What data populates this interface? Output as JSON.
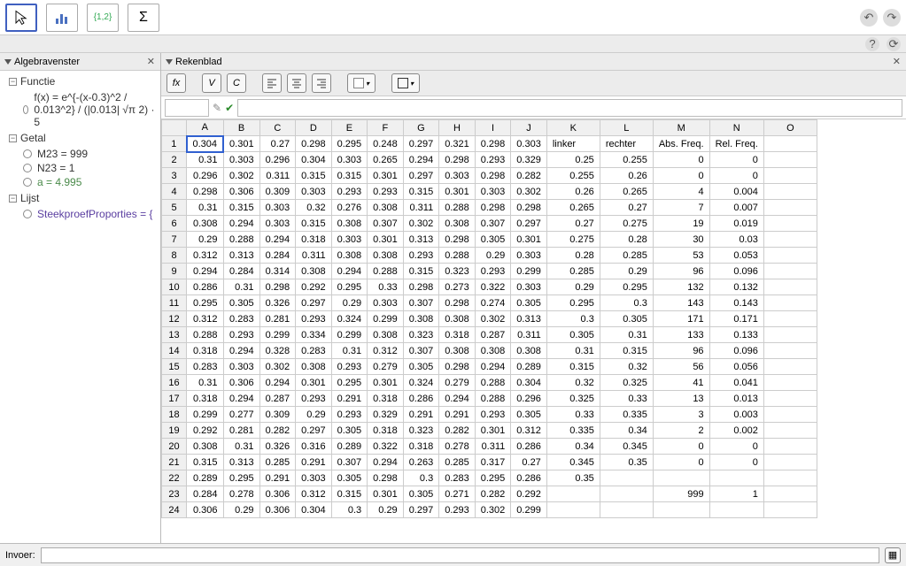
{
  "leftPanel": {
    "title": "Algebravenster",
    "sections": [
      {
        "label": "Functie",
        "items": [
          {
            "text": "f(x) = e^{-(x-0.3)^2 / 0.013^2} / (|0.013| √π 2) · 5"
          }
        ]
      },
      {
        "label": "Getal",
        "items": [
          {
            "text": "M23 = 999"
          },
          {
            "text": "N23 = 1"
          },
          {
            "text": "a = 4.995",
            "cls": "special"
          }
        ]
      },
      {
        "label": "Lijst",
        "items": [
          {
            "text": "SteekproefProporties = {",
            "cls": "purple"
          }
        ]
      }
    ]
  },
  "sheet": {
    "title": "Rekenblad",
    "buttons": {
      "fx": "fx",
      "v": "V",
      "c": "C"
    },
    "columns": [
      "A",
      "B",
      "C",
      "D",
      "E",
      "F",
      "G",
      "H",
      "I",
      "J",
      "K",
      "L",
      "M",
      "N",
      "O"
    ],
    "headerRow": {
      "K": "linker",
      "L": "rechter",
      "M": "Abs. Freq.",
      "N": "Rel. Freq."
    },
    "rows": [
      {
        "n": 1,
        "A": 0.304,
        "B": 0.301,
        "C": 0.27,
        "D": 0.298,
        "E": 0.295,
        "F": 0.248,
        "G": 0.297,
        "H": 0.321,
        "I": 0.298,
        "J": 0.303
      },
      {
        "n": 2,
        "A": 0.31,
        "B": 0.303,
        "C": 0.296,
        "D": 0.304,
        "E": 0.303,
        "F": 0.265,
        "G": 0.294,
        "H": 0.298,
        "I": 0.293,
        "J": 0.329,
        "K": 0.25,
        "L": 0.255,
        "M": 0,
        "N": 0
      },
      {
        "n": 3,
        "A": 0.296,
        "B": 0.302,
        "C": 0.311,
        "D": 0.315,
        "E": 0.315,
        "F": 0.301,
        "G": 0.297,
        "H": 0.303,
        "I": 0.298,
        "J": 0.282,
        "K": 0.255,
        "L": 0.26,
        "M": 0,
        "N": 0
      },
      {
        "n": 4,
        "A": 0.298,
        "B": 0.306,
        "C": 0.309,
        "D": 0.303,
        "E": 0.293,
        "F": 0.293,
        "G": 0.315,
        "H": 0.301,
        "I": 0.303,
        "J": 0.302,
        "K": 0.26,
        "L": 0.265,
        "M": 4,
        "N": 0.004
      },
      {
        "n": 5,
        "A": 0.31,
        "B": 0.315,
        "C": 0.303,
        "D": 0.32,
        "E": 0.276,
        "F": 0.308,
        "G": 0.311,
        "H": 0.288,
        "I": 0.298,
        "J": 0.298,
        "K": 0.265,
        "L": 0.27,
        "M": 7,
        "N": 0.007
      },
      {
        "n": 6,
        "A": 0.308,
        "B": 0.294,
        "C": 0.303,
        "D": 0.315,
        "E": 0.308,
        "F": 0.307,
        "G": 0.302,
        "H": 0.308,
        "I": 0.307,
        "J": 0.297,
        "K": 0.27,
        "L": 0.275,
        "M": 19,
        "N": 0.019
      },
      {
        "n": 7,
        "A": 0.29,
        "B": 0.288,
        "C": 0.294,
        "D": 0.318,
        "E": 0.303,
        "F": 0.301,
        "G": 0.313,
        "H": 0.298,
        "I": 0.305,
        "J": 0.301,
        "K": 0.275,
        "L": 0.28,
        "M": 30,
        "N": 0.03
      },
      {
        "n": 8,
        "A": 0.312,
        "B": 0.313,
        "C": 0.284,
        "D": 0.311,
        "E": 0.308,
        "F": 0.308,
        "G": 0.293,
        "H": 0.288,
        "I": 0.29,
        "J": 0.303,
        "K": 0.28,
        "L": 0.285,
        "M": 53,
        "N": 0.053
      },
      {
        "n": 9,
        "A": 0.294,
        "B": 0.284,
        "C": 0.314,
        "D": 0.308,
        "E": 0.294,
        "F": 0.288,
        "G": 0.315,
        "H": 0.323,
        "I": 0.293,
        "J": 0.299,
        "K": 0.285,
        "L": 0.29,
        "M": 96,
        "N": 0.096
      },
      {
        "n": 10,
        "A": 0.286,
        "B": 0.31,
        "C": 0.298,
        "D": 0.292,
        "E": 0.295,
        "F": 0.33,
        "G": 0.298,
        "H": 0.273,
        "I": 0.322,
        "J": 0.303,
        "K": 0.29,
        "L": 0.295,
        "M": 132,
        "N": 0.132
      },
      {
        "n": 11,
        "A": 0.295,
        "B": 0.305,
        "C": 0.326,
        "D": 0.297,
        "E": 0.29,
        "F": 0.303,
        "G": 0.307,
        "H": 0.298,
        "I": 0.274,
        "J": 0.305,
        "K": 0.295,
        "L": 0.3,
        "M": 143,
        "N": 0.143
      },
      {
        "n": 12,
        "A": 0.312,
        "B": 0.283,
        "C": 0.281,
        "D": 0.293,
        "E": 0.324,
        "F": 0.299,
        "G": 0.308,
        "H": 0.308,
        "I": 0.302,
        "J": 0.313,
        "K": 0.3,
        "L": 0.305,
        "M": 171,
        "N": 0.171
      },
      {
        "n": 13,
        "A": 0.288,
        "B": 0.293,
        "C": 0.299,
        "D": 0.334,
        "E": 0.299,
        "F": 0.308,
        "G": 0.323,
        "H": 0.318,
        "I": 0.287,
        "J": 0.311,
        "K": 0.305,
        "L": 0.31,
        "M": 133,
        "N": 0.133
      },
      {
        "n": 14,
        "A": 0.318,
        "B": 0.294,
        "C": 0.328,
        "D": 0.283,
        "E": 0.31,
        "F": 0.312,
        "G": 0.307,
        "H": 0.308,
        "I": 0.308,
        "J": 0.308,
        "K": 0.31,
        "L": 0.315,
        "M": 96,
        "N": 0.096
      },
      {
        "n": 15,
        "A": 0.283,
        "B": 0.303,
        "C": 0.302,
        "D": 0.308,
        "E": 0.293,
        "F": 0.279,
        "G": 0.305,
        "H": 0.298,
        "I": 0.294,
        "J": 0.289,
        "K": 0.315,
        "L": 0.32,
        "M": 56,
        "N": 0.056
      },
      {
        "n": 16,
        "A": 0.31,
        "B": 0.306,
        "C": 0.294,
        "D": 0.301,
        "E": 0.295,
        "F": 0.301,
        "G": 0.324,
        "H": 0.279,
        "I": 0.288,
        "J": 0.304,
        "K": 0.32,
        "L": 0.325,
        "M": 41,
        "N": 0.041
      },
      {
        "n": 17,
        "A": 0.318,
        "B": 0.294,
        "C": 0.287,
        "D": 0.293,
        "E": 0.291,
        "F": 0.318,
        "G": 0.286,
        "H": 0.294,
        "I": 0.288,
        "J": 0.296,
        "K": 0.325,
        "L": 0.33,
        "M": 13,
        "N": 0.013
      },
      {
        "n": 18,
        "A": 0.299,
        "B": 0.277,
        "C": 0.309,
        "D": 0.29,
        "E": 0.293,
        "F": 0.329,
        "G": 0.291,
        "H": 0.291,
        "I": 0.293,
        "J": 0.305,
        "K": 0.33,
        "L": 0.335,
        "M": 3,
        "N": 0.003
      },
      {
        "n": 19,
        "A": 0.292,
        "B": 0.281,
        "C": 0.282,
        "D": 0.297,
        "E": 0.305,
        "F": 0.318,
        "G": 0.323,
        "H": 0.282,
        "I": 0.301,
        "J": 0.312,
        "K": 0.335,
        "L": 0.34,
        "M": 2,
        "N": 0.002
      },
      {
        "n": 20,
        "A": 0.308,
        "B": 0.31,
        "C": 0.326,
        "D": 0.316,
        "E": 0.289,
        "F": 0.322,
        "G": 0.318,
        "H": 0.278,
        "I": 0.311,
        "J": 0.286,
        "K": 0.34,
        "L": 0.345,
        "M": 0,
        "N": 0
      },
      {
        "n": 21,
        "A": 0.315,
        "B": 0.313,
        "C": 0.285,
        "D": 0.291,
        "E": 0.307,
        "F": 0.294,
        "G": 0.263,
        "H": 0.285,
        "I": 0.317,
        "J": 0.27,
        "K": 0.345,
        "L": 0.35,
        "M": 0,
        "N": 0
      },
      {
        "n": 22,
        "A": 0.289,
        "B": 0.295,
        "C": 0.291,
        "D": 0.303,
        "E": 0.305,
        "F": 0.298,
        "G": 0.3,
        "H": 0.283,
        "I": 0.295,
        "J": 0.286,
        "K": 0.35
      },
      {
        "n": 23,
        "A": 0.284,
        "B": 0.278,
        "C": 0.306,
        "D": 0.312,
        "E": 0.315,
        "F": 0.301,
        "G": 0.305,
        "H": 0.271,
        "I": 0.282,
        "J": 0.292,
        "M": 999,
        "N": 1
      },
      {
        "n": 24,
        "A": 0.306,
        "B": 0.29,
        "C": 0.306,
        "D": 0.304,
        "E": 0.3,
        "F": 0.29,
        "G": 0.297,
        "H": 0.293,
        "I": 0.302,
        "J": 0.299
      }
    ],
    "selectedCell": {
      "row": 1,
      "col": "A"
    }
  },
  "inputBar": {
    "label": "Invoer:",
    "value": ""
  }
}
